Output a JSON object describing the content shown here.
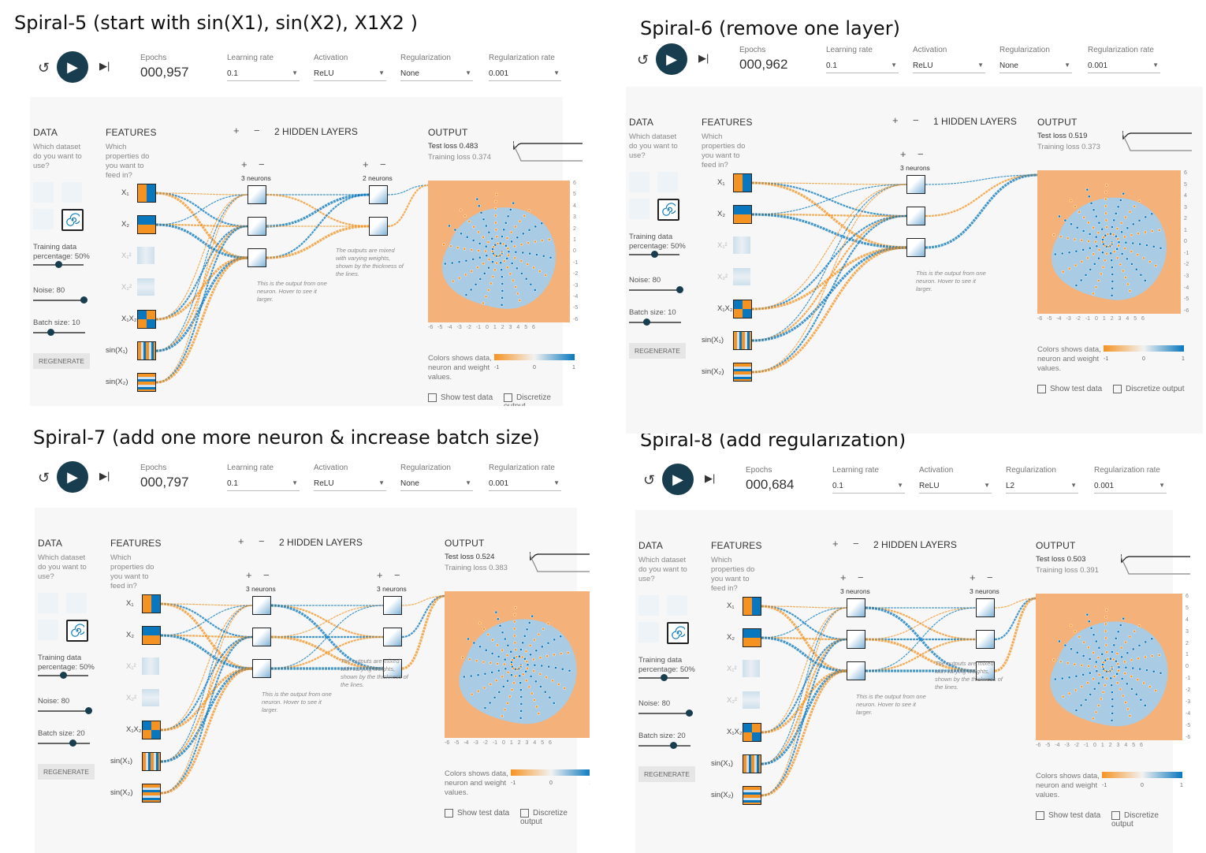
{
  "captions": {
    "s5": "Spiral-5 (start with sin(X1), sin(X2), X1X2 )",
    "s6": "Spiral-6 (remove one layer)",
    "s7": "Spiral-7 (add one more neuron & increase batch size)",
    "s8": "Spiral-8 (add regularization)"
  },
  "ui": {
    "epochs_label": "Epochs",
    "lr_label": "Learning rate",
    "act_label": "Activation",
    "reg_label": "Regularization",
    "regrate_label": "Regularization rate",
    "data_title": "DATA",
    "data_sub": "Which dataset do you want to use?",
    "features_title": "FEATURES",
    "features_sub": "Which properties do you want to feed in?",
    "hidden_suffix": "HIDDEN LAYERS",
    "output_title": "OUTPUT",
    "training_pct": "Training data percentage:",
    "noise_label": "Noise:",
    "batch_label": "Batch size:",
    "regen": "REGENERATE",
    "colors_note": "Colors shows data, neuron and weight values.",
    "grad_min": "-1",
    "grad_mid": "0",
    "grad_max": "1",
    "show_test": "Show test data",
    "discretize": "Discretize output",
    "note_neuron": "This is the output from one neuron. Hover to see it larger.",
    "note_weights": "The outputs are mixed with varying weights, shown by the thickness of the lines.",
    "feat_x1": "X₁",
    "feat_x2": "X₂",
    "feat_x1sq": "X₁²",
    "feat_x2sq": "X₂²",
    "feat_x1x2": "X₁X₂",
    "feat_sin1": "sin(X₁)",
    "feat_sin2": "sin(X₂)",
    "plus": "+",
    "minus": "−",
    "ticks_x": "-6 -5 -4 -3 -2 -1 0 1 2 3 4 5 6",
    "ticks_y": [
      "6",
      "5",
      "4",
      "3",
      "2",
      "1",
      "0",
      "-1",
      "-2",
      "-3",
      "-4",
      "-5",
      "-6"
    ],
    "icons": {
      "reset": "reset-icon",
      "play": "play-icon",
      "step": "step-icon",
      "spiral": "spiral-dataset-icon"
    }
  },
  "panels": [
    {
      "id": "s5",
      "epochs": "000,957",
      "lr": "0.1",
      "act": "ReLU",
      "reg": "None",
      "regrate": "0.001",
      "hidden": "2",
      "layers": [
        "3 neurons",
        "2 neurons"
      ],
      "test_loss": "Test loss 0.483",
      "train_loss": "Training loss 0.374",
      "pct": "50%",
      "noise": "80",
      "batch": "10"
    },
    {
      "id": "s6",
      "epochs": "000,962",
      "lr": "0.1",
      "act": "ReLU",
      "reg": "None",
      "regrate": "0.001",
      "hidden": "1",
      "layers": [
        "3 neurons"
      ],
      "test_loss": "Test loss 0.519",
      "train_loss": "Training loss 0.373",
      "pct": "50%",
      "noise": "80",
      "batch": "10"
    },
    {
      "id": "s7",
      "epochs": "000,797",
      "lr": "0.1",
      "act": "ReLU",
      "reg": "None",
      "regrate": "0.001",
      "hidden": "2",
      "layers": [
        "3 neurons",
        "3 neurons"
      ],
      "test_loss": "Test loss 0.524",
      "train_loss": "Training loss 0.383",
      "pct": "50%",
      "noise": "80",
      "batch": "20"
    },
    {
      "id": "s8",
      "epochs": "000,684",
      "lr": "0.1",
      "act": "ReLU",
      "reg": "L2",
      "regrate": "0.001",
      "hidden": "2",
      "layers": [
        "3 neurons",
        "3 neurons"
      ],
      "test_loss": "Test loss 0.503",
      "train_loss": "Training loss 0.391",
      "pct": "50%",
      "noise": "80",
      "batch": "20"
    }
  ],
  "colors": {
    "orange": "#f59322",
    "blue": "#0877bd",
    "play": "#183d4e"
  }
}
